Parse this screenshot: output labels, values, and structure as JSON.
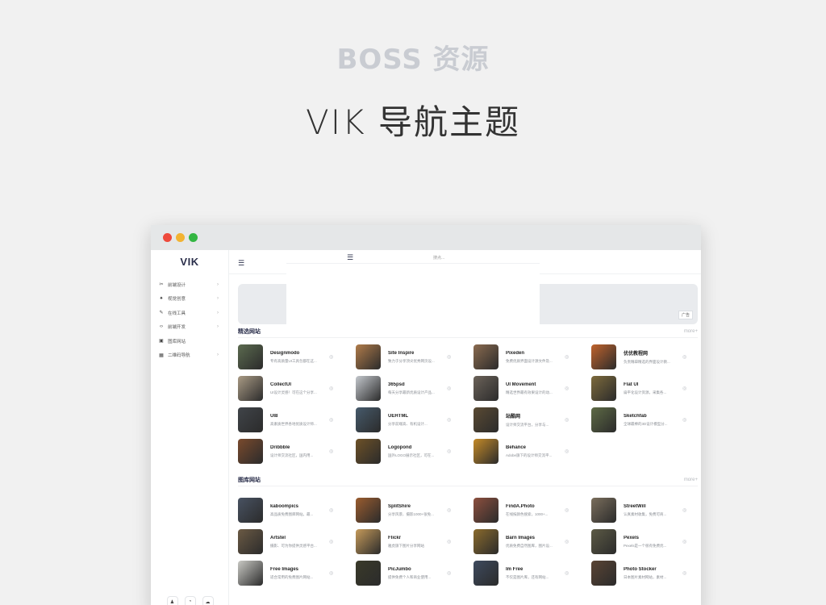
{
  "header": {
    "brand": "BOSS 资源",
    "title": "VIK 导航主题"
  },
  "window": {
    "colors": {
      "red": "#ee4a3c",
      "yellow": "#f2b332",
      "green": "#33b642"
    }
  },
  "sidebar": {
    "logo": "VIK",
    "items": [
      {
        "icon": "scissors-icon",
        "glyph": "✂",
        "label": "前端设计",
        "arrow": "›"
      },
      {
        "icon": "flame-icon",
        "glyph": "♠",
        "label": "视觉创意",
        "arrow": "›"
      },
      {
        "icon": "pen-icon",
        "glyph": "✎",
        "label": "在线工具",
        "arrow": "›"
      },
      {
        "icon": "code-icon",
        "glyph": "‹›",
        "label": "前端开发",
        "arrow": "›"
      },
      {
        "icon": "image-icon",
        "glyph": "▣",
        "label": "图库网站",
        "arrow": ""
      },
      {
        "icon": "qrcode-icon",
        "glyph": "▦",
        "label": "二维码导航",
        "arrow": "›"
      }
    ],
    "footer": [
      {
        "icon": "qq-icon",
        "glyph": "♟"
      },
      {
        "icon": "weibo-icon",
        "glyph": "◔"
      },
      {
        "icon": "wechat-icon",
        "glyph": "☁"
      }
    ]
  },
  "main": {
    "hamburger": "☰",
    "ad_label": "广告",
    "preview": {
      "search_placeholder": "搜点..."
    },
    "sections": [
      {
        "title": "精选网站",
        "more": "more+",
        "items": [
          {
            "name": "Designmodo",
            "desc": "专有高质量UI工具包都在这...",
            "color": "#5b6a4f"
          },
          {
            "name": "Site Inspire",
            "desc": "致力于分享顶尖优秀网页设...",
            "color": "#b07b4a"
          },
          {
            "name": "Pixeden",
            "desc": "免费优质界面设计源文件及...",
            "color": "#8a6a4f"
          },
          {
            "name": "优优教程网",
            "desc": "负责精辟精选的界面设计教...",
            "color": "#c0632c"
          },
          {
            "name": "CollectUI",
            "desc": "UI设计灵感！可在这个分享...",
            "color": "#a99a84"
          },
          {
            "name": "365psd",
            "desc": "每天分享最新优质设计产品...",
            "color": "#c3c7cc"
          },
          {
            "name": "UI Movement",
            "desc": "精选世界最有效果设计的动...",
            "color": "#6b6259"
          },
          {
            "name": "Flat UI",
            "desc": "扁平化设计资源，采集各...",
            "color": "#7d6a3c"
          },
          {
            "name": "UI8",
            "desc": "高素质世界各地优质设计师...",
            "color": "#404449"
          },
          {
            "name": "UEHTML",
            "desc": "分享前端高、有机设计...",
            "color": "#465a6b"
          },
          {
            "name": "站酷网",
            "desc": "设计师交流平台，分享与...",
            "color": "#5a4a33"
          },
          {
            "name": "Sketchfab",
            "desc": "全球最棒的3D设计模型分...",
            "color": "#5e6a45"
          },
          {
            "name": "Dribbble",
            "desc": "设计师交流社区，国内用...",
            "color": "#7a4a2d"
          },
          {
            "name": "Logopond",
            "desc": "国外LOGO展示社区，可在...",
            "color": "#6d5127"
          },
          {
            "name": "Behance",
            "desc": "Adobe旗下的设计师交流平...",
            "color": "#c48a28"
          }
        ]
      },
      {
        "title": "图库网站",
        "more": "more+",
        "items": [
          {
            "name": "kaboompics",
            "desc": "高品质免费图库网站。最...",
            "color": "#485262"
          },
          {
            "name": "SplitShire",
            "desc": "分享风景、摄影1000+张免...",
            "color": "#9a5c2f"
          },
          {
            "name": "FindA.Photo",
            "desc": "在线按颜色搜索，1000+...",
            "color": "#8c4f3e"
          },
          {
            "name": "StreetWill",
            "desc": "认真素材收集，免费可商...",
            "color": "#7a6e5c"
          },
          {
            "name": "Artstel",
            "desc": "摄影、可为你提供灵感平台...",
            "color": "#6b5a44"
          },
          {
            "name": "Flickr",
            "desc": "雅虎旗下图片分享网站",
            "color": "#c59a5a"
          },
          {
            "name": "Barn Images",
            "desc": "优质免费自然图库，图片设...",
            "color": "#8a6a2c"
          },
          {
            "name": "Pexels",
            "desc": "Pexels是一个很有免费优...",
            "color": "#5c5a45"
          },
          {
            "name": "Free Images",
            "desc": "适合常用的免费图片网站...",
            "color": "#c9c9c4"
          },
          {
            "name": "PicJumbo",
            "desc": "提供免费个人和商业使用...",
            "color": "#3a3a2a"
          },
          {
            "name": "Im Free",
            "desc": "不仅是图片库，还有网站...",
            "color": "#3e4a5e"
          },
          {
            "name": "Photo Stocker",
            "desc": "日本图片素材网站，素材...",
            "color": "#5a4434"
          }
        ]
      }
    ]
  }
}
